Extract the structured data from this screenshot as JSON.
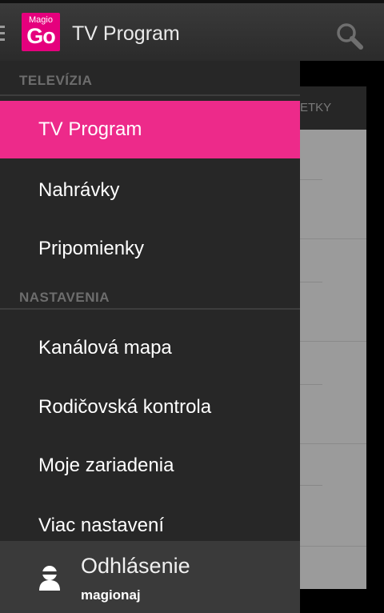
{
  "actionbar": {
    "logo_small": "Magio",
    "logo_big": "Go",
    "title": "TV Program",
    "search_icon": "search-icon"
  },
  "background": {
    "tab_partial": "ETKY"
  },
  "drawer": {
    "sections": [
      {
        "label": "TELEVÍZIA"
      },
      {
        "label": "NASTAVENIA"
      }
    ],
    "items": [
      {
        "label": "TV Program",
        "active": true
      },
      {
        "label": "Nahrávky"
      },
      {
        "label": "Pripomienky"
      },
      {
        "label": "Kanálová mapa"
      },
      {
        "label": "Rodičovská kontrola"
      },
      {
        "label": "Moje zariadenia"
      },
      {
        "label": "Viac nastavení"
      }
    ],
    "footer": {
      "label": "Odhlásenie",
      "username": "magionaj",
      "icon": "user-icon"
    }
  },
  "colors": {
    "accent": "#ed2a8a",
    "logo": "#e5007d"
  }
}
